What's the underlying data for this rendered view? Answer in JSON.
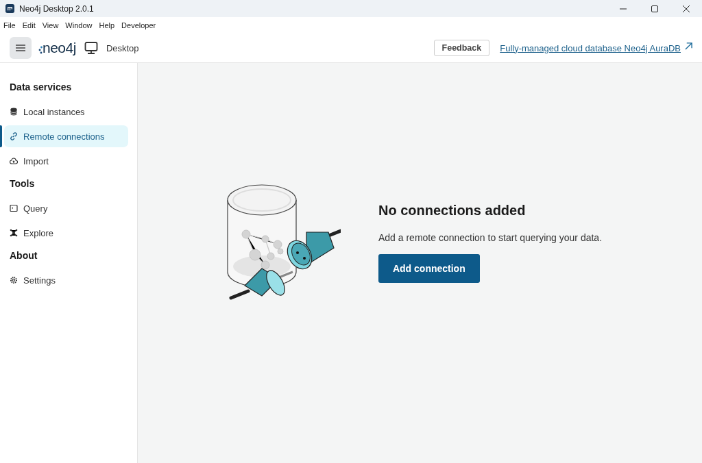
{
  "window": {
    "title": "Neo4j Desktop 2.0.1"
  },
  "menu": [
    "File",
    "Edit",
    "View",
    "Window",
    "Help",
    "Developer"
  ],
  "header": {
    "logo": "neo4j",
    "product": "Desktop",
    "feedback": "Feedback",
    "promo_link": "Fully-managed cloud database Neo4j AuraDB"
  },
  "sidebar": {
    "sections": [
      {
        "title": "Data services",
        "items": [
          {
            "label": "Local instances",
            "kind": "database",
            "selected": false
          },
          {
            "label": "Remote connections",
            "kind": "link",
            "selected": true
          },
          {
            "label": "Import",
            "kind": "cloud",
            "selected": false
          }
        ]
      },
      {
        "title": "Tools",
        "items": [
          {
            "label": "Query",
            "kind": "terminal",
            "selected": false
          },
          {
            "label": "Explore",
            "kind": "graph",
            "selected": false
          }
        ]
      },
      {
        "title": "About",
        "items": [
          {
            "label": "Settings",
            "kind": "gear",
            "selected": false
          }
        ]
      }
    ]
  },
  "empty_state": {
    "heading": "No connections added",
    "message": "Add a remote connection to start querying your data.",
    "button": "Add connection"
  }
}
